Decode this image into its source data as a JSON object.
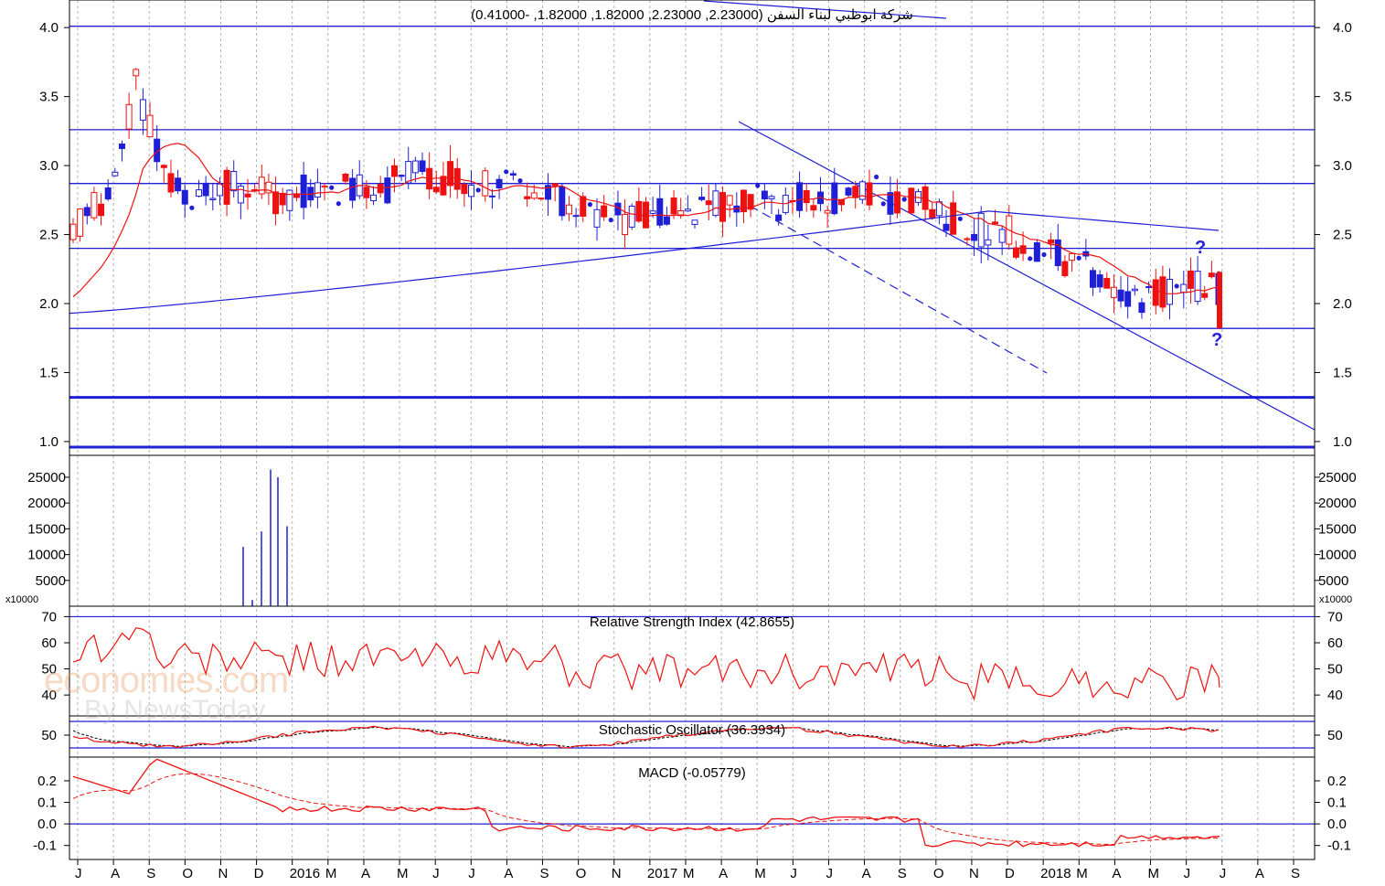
{
  "watermark": {
    "brand": "economies.com",
    "sub": "By NewsToday"
  },
  "chart_data": [
    {
      "type": "candlestick",
      "title": "شركة ابوظبي لبناء السفن (2.23000, 2.23000, 1.82000, 1.82000, -0.41000)",
      "ylim": [
        0.9,
        4.2
      ],
      "yticks": [
        "4.0",
        "3.5",
        "3.0",
        "2.5",
        "2.0",
        "1.5",
        "1.0"
      ],
      "ytick_values": [
        4.0,
        3.5,
        3.0,
        2.5,
        2.0,
        1.5,
        1.0
      ],
      "grid": true,
      "horizontal_levels": [
        4.01,
        3.26,
        2.87,
        2.4,
        1.82,
        1.32,
        0.96
      ],
      "price_min": 1.8,
      "price_max": 4.0,
      "sma_long_start": 1.93,
      "sma_long_peak": 2.67,
      "sma_long_end": 2.53,
      "question_marks": [
        "?",
        "?"
      ]
    },
    {
      "type": "bar",
      "name": "volume",
      "yticks": [
        "25000",
        "20000",
        "15000",
        "10000",
        "5000"
      ],
      "ytick_values": [
        25000,
        20000,
        15000,
        10000,
        5000
      ],
      "multiplier_label": "x10000",
      "ylim": [
        0,
        28000
      ],
      "values": [
        11500,
        1200,
        14500,
        26500,
        25000,
        15500
      ]
    },
    {
      "type": "line",
      "title": "Relative Strength Index (42.8655)",
      "yticks": [
        "70",
        "60",
        "50",
        "40"
      ],
      "ytick_values": [
        70,
        60,
        50,
        40
      ],
      "ylim": [
        32,
        74
      ],
      "levels": [
        70,
        30
      ],
      "last_value": 42.8655
    },
    {
      "type": "line",
      "title": "Stochastic Oscillator (36.3934)",
      "yticks": [
        "50"
      ],
      "ytick_values": [
        50
      ],
      "last_value": 36.3934
    },
    {
      "type": "line",
      "title": "MACD (-0.05779)",
      "yticks": [
        "0.2",
        "0.1",
        "0.0",
        "-0.1"
      ],
      "ytick_values": [
        0.2,
        0.1,
        0.0,
        -0.1
      ],
      "ylim": [
        -0.165,
        0.31
      ],
      "last_value": -0.05779
    }
  ],
  "x_axis_labels": [
    "J",
    "A",
    "S",
    "O",
    "N",
    "D",
    "2016",
    "M",
    "A",
    "M",
    "J",
    "J",
    "A",
    "S",
    "O",
    "N",
    "2017",
    "M",
    "A",
    "M",
    "J",
    "J",
    "A",
    "S",
    "O",
    "N",
    "D",
    "2018",
    "M",
    "A",
    "M",
    "J",
    "J",
    "A",
    "S"
  ]
}
